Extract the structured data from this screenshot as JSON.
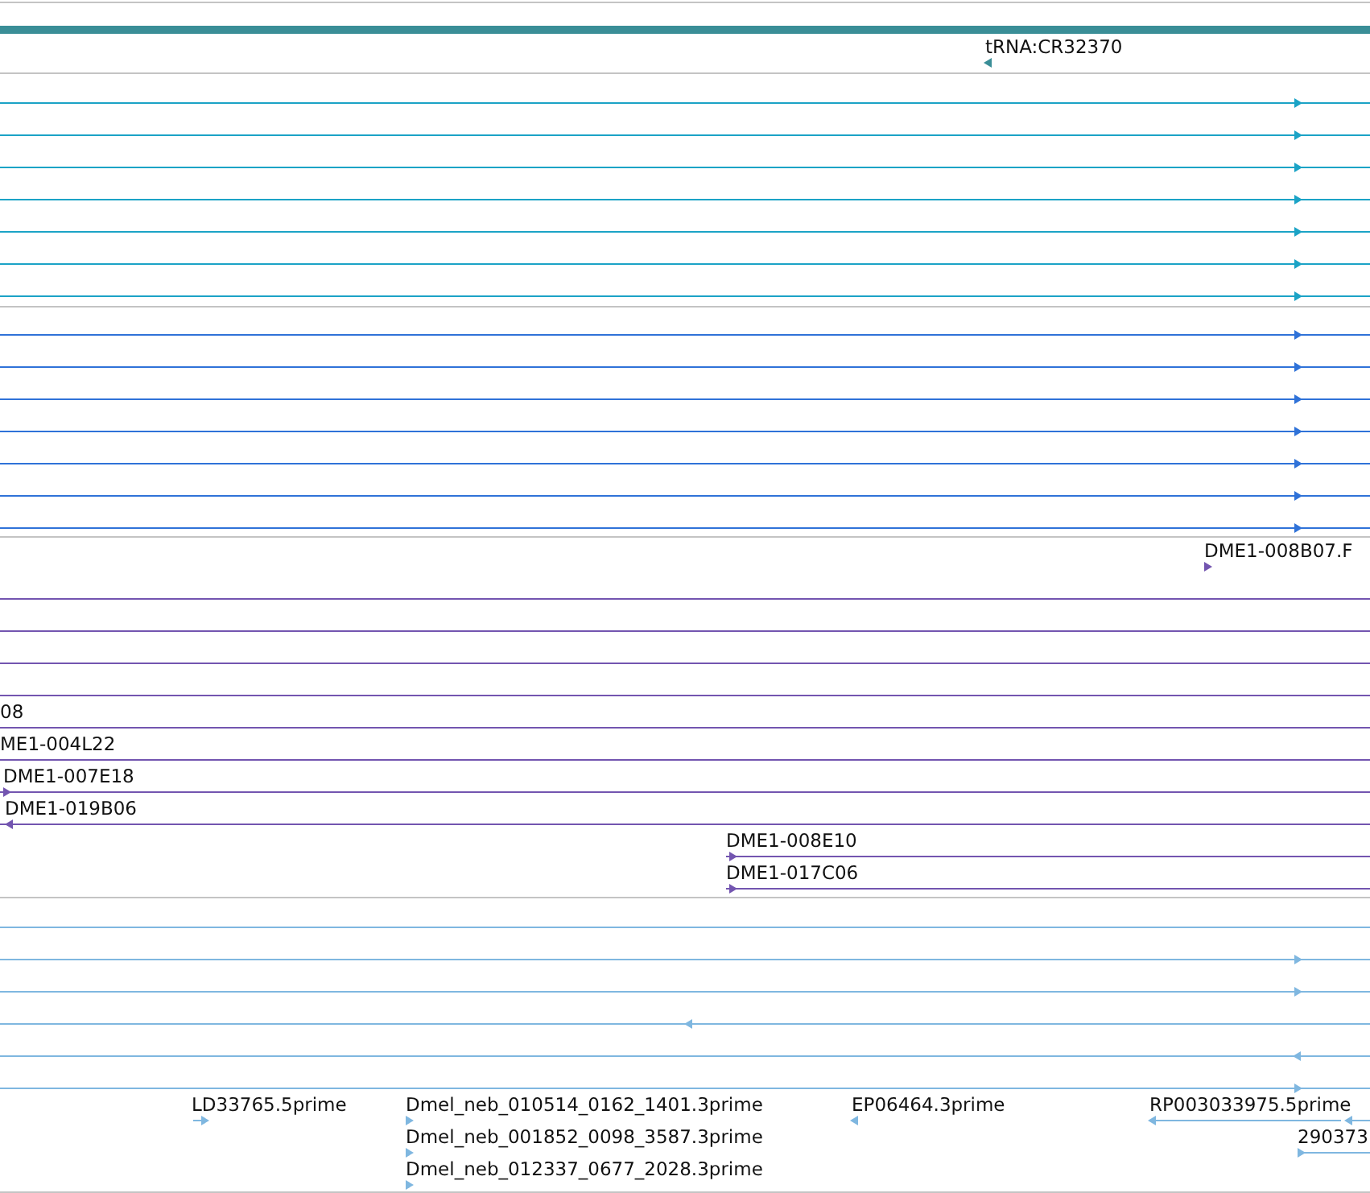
{
  "tracks": [
    {
      "color": "#3a8e97",
      "features": [
        {
          "label": "tRNA:CR32370",
          "kind": "reverse"
        }
      ]
    },
    {
      "color": "#1ba3c6",
      "features": [
        {
          "kind": "forward"
        },
        {
          "kind": "forward"
        },
        {
          "kind": "forward"
        },
        {
          "kind": "forward"
        },
        {
          "kind": "forward"
        },
        {
          "kind": "forward"
        },
        {
          "kind": "forward"
        }
      ]
    },
    {
      "color": "#2f72d8",
      "features": [
        {
          "kind": "forward"
        },
        {
          "kind": "forward"
        },
        {
          "kind": "forward"
        },
        {
          "kind": "forward"
        },
        {
          "kind": "forward"
        },
        {
          "kind": "forward"
        },
        {
          "kind": "forward"
        }
      ]
    },
    {
      "color": "#7355b0",
      "features": [
        {
          "label": "DME1-008B07.F",
          "kind": "forward"
        },
        {
          "kind": "plain"
        },
        {
          "kind": "plain"
        },
        {
          "kind": "plain"
        },
        {
          "kind": "plain"
        },
        {
          "label": "08",
          "kind": "plain"
        },
        {
          "label": "ME1-004L22",
          "kind": "plain"
        },
        {
          "label": "DME1-007E18",
          "kind": "forward"
        },
        {
          "label": "DME1-019B06",
          "kind": "reverse"
        },
        {
          "label": "DME1-008E10",
          "kind": "forward"
        },
        {
          "label": "DME1-017C06",
          "kind": "forward"
        }
      ]
    },
    {
      "color": "#7fb7e0",
      "features": [
        {
          "kind": "plain"
        },
        {
          "kind": "forward"
        },
        {
          "kind": "forward"
        },
        {
          "kind": "reverse"
        },
        {
          "kind": "reverse"
        },
        {
          "kind": "forward"
        },
        {
          "label": "LD33765.5prime",
          "kind": "forward"
        },
        {
          "label": "Dmel_neb_010514_0162_1401.3prime",
          "kind": "forward"
        },
        {
          "label": "EP06464.3prime",
          "kind": "reverse"
        },
        {
          "label": "RP003033975.5prime",
          "kind": "reverse"
        },
        {
          "kind": "reverse"
        },
        {
          "label": "Dmel_neb_001852_0098_3587.3prime",
          "kind": "forward"
        },
        {
          "label": "290373",
          "kind": "forward"
        },
        {
          "label": "Dmel_neb_012337_0677_2028.3prime",
          "kind": "forward"
        }
      ]
    }
  ]
}
